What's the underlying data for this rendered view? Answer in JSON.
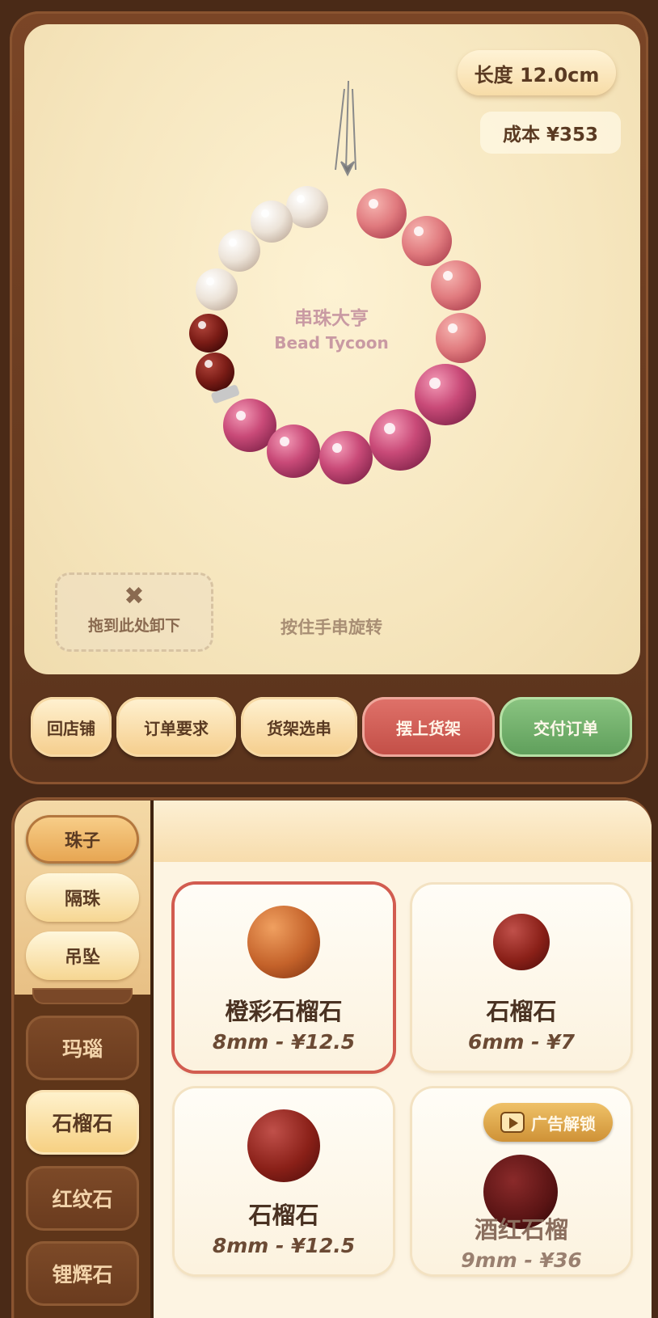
{
  "stage": {
    "length_label": "长度 12.0cm",
    "cost_label": "成本 ¥353",
    "brand_cn": "串珠大亨",
    "brand_en": "Bead Tycoon",
    "drop_zone_icon": "✖",
    "drop_zone_label": "拖到此处卸下",
    "rotate_hint": "按住手串旋转"
  },
  "actions": {
    "back_to_shop": "回店铺",
    "order_requirements": "订单要求",
    "shelf_pick": "货架选串",
    "put_on_shelf": "摆上货架",
    "deliver_order": "交付订单"
  },
  "categories": [
    "珠子",
    "隔珠",
    "吊坠"
  ],
  "stones": [
    "玛瑙",
    "石榴石",
    "红纹石",
    "锂辉石"
  ],
  "products": [
    {
      "name": "橙彩石榴石",
      "price": "8mm - ¥12.5"
    },
    {
      "name": "石榴石",
      "price": "6mm - ¥7"
    },
    {
      "name": "石榴石",
      "price": "8mm - ¥12.5"
    },
    {
      "name": "酒红石榴",
      "price": "9mm - ¥36",
      "badge": "广告解锁"
    }
  ],
  "colors": {
    "frame": "#6b3f22",
    "accent_red": "#c24e46",
    "accent_green": "#5e9e5a",
    "bead_pink": "#c94a78",
    "bead_rose": "#e07a7e",
    "bead_white": "#ece3d8",
    "bead_garnet": "#7a1c16"
  }
}
